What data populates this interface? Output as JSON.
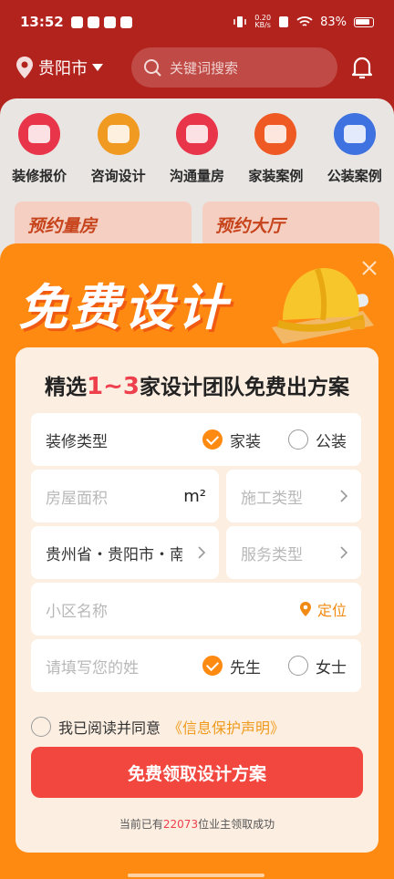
{
  "status_bar": {
    "time": "13:52",
    "net_speed_value": "0.20",
    "net_speed_unit": "KB/s",
    "battery": "83%"
  },
  "header": {
    "city": "贵阳市",
    "search_placeholder": "关键词搜索"
  },
  "categories": [
    {
      "label": "装修报价",
      "color": "#e8354a"
    },
    {
      "label": "咨询设计",
      "color": "#f19a22"
    },
    {
      "label": "沟通量房",
      "color": "#e8354a"
    },
    {
      "label": "家装案例",
      "color": "#ef5a24"
    },
    {
      "label": "公装案例",
      "color": "#3d72e0"
    }
  ],
  "promos": [
    "预约量房",
    "预约大厅"
  ],
  "modal": {
    "hero_title": "免费设计",
    "card_title": {
      "prefix": "精选",
      "highlight": "1~3",
      "suffix": "家设计团队免费出方案"
    },
    "decor_type": {
      "label": "装修类型",
      "options": [
        "家装",
        "公装"
      ],
      "selected": "家装"
    },
    "area": {
      "placeholder": "房屋面积",
      "unit": "m²"
    },
    "construction_type": {
      "placeholder": "施工类型"
    },
    "region": {
      "value": "贵州省・贵阳市・南"
    },
    "service_type": {
      "placeholder": "服务类型"
    },
    "community": {
      "placeholder": "小区名称",
      "locate_label": "定位"
    },
    "surname": {
      "placeholder": "请填写您的姓",
      "options": [
        "先生",
        "女士"
      ],
      "selected": "先生"
    },
    "agreement": {
      "text": "我已阅读并同意",
      "link": "《信息保护声明》"
    },
    "submit_label": "免费领取设计方案",
    "footer": {
      "prefix": "当前已有",
      "count": "22073",
      "suffix": "位业主领取成功"
    }
  }
}
